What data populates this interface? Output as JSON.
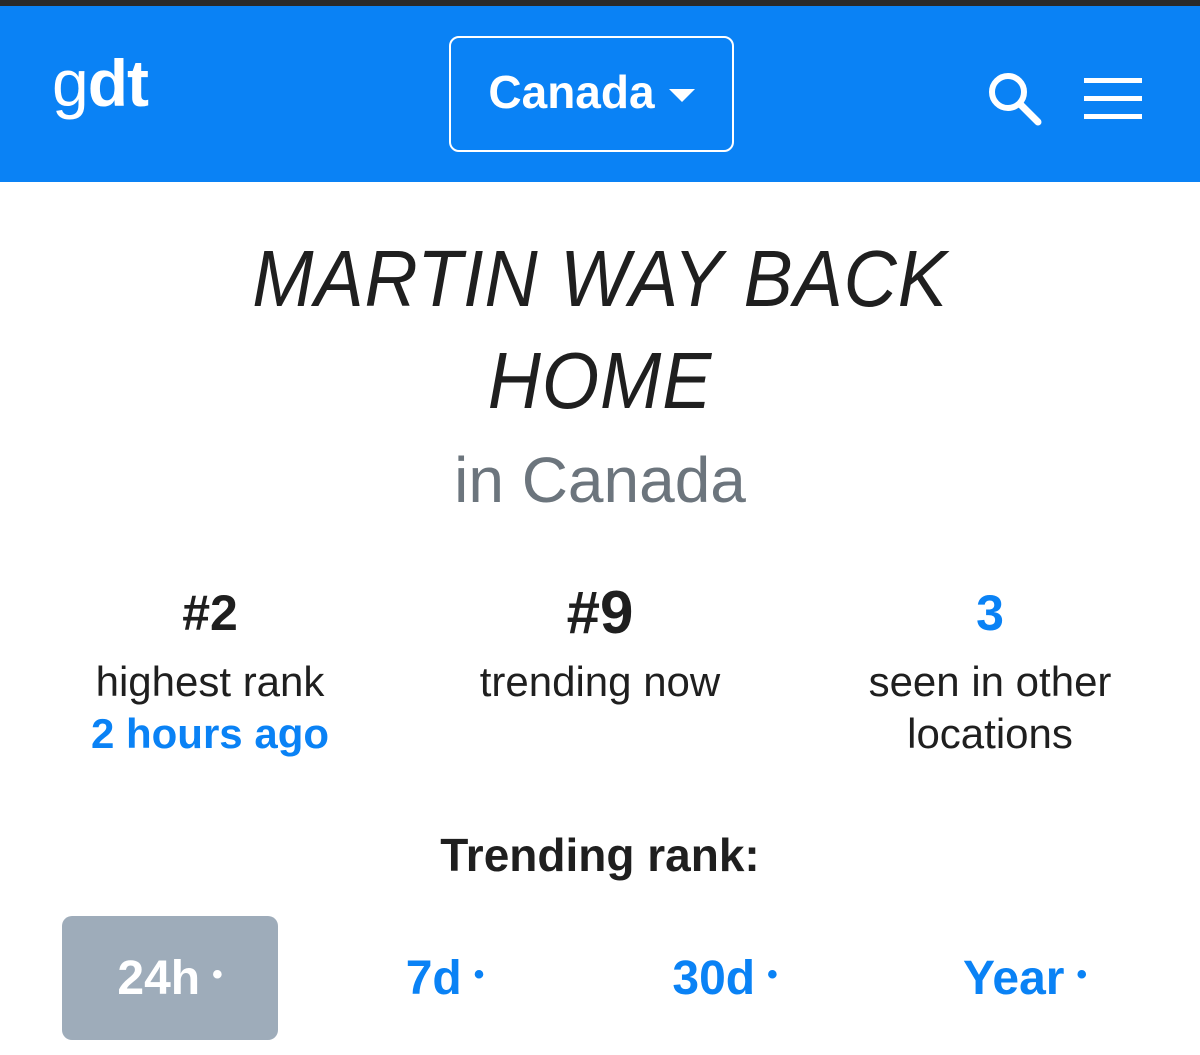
{
  "header": {
    "logo_prefix": "g",
    "logo_suffix": "dt",
    "country": "Canada",
    "icons": [
      "search-icon",
      "hamburger-menu-icon"
    ]
  },
  "trend": {
    "title": "MARTIN WAY BACK HOME",
    "subtitle": "in Canada"
  },
  "stats": [
    {
      "value": "#2",
      "label": "highest rank",
      "link": "2 hours ago"
    },
    {
      "value": "#9",
      "label": "trending now"
    },
    {
      "value": "3",
      "label": "seen in other locations"
    }
  ],
  "rank_section": {
    "title": "Trending rank:",
    "tabs": [
      {
        "label": "24h",
        "dot": "•",
        "active": true
      },
      {
        "label": "7d",
        "dot": "•",
        "active": false
      },
      {
        "label": "30d",
        "dot": "•",
        "active": false
      },
      {
        "label": "Year",
        "dot": "•",
        "active": false
      }
    ]
  },
  "colors": {
    "brand_blue": "#0a82f5",
    "active_tab_bg": "#9eacba",
    "muted_text": "#6c757d",
    "text": "#1f1f1f"
  }
}
